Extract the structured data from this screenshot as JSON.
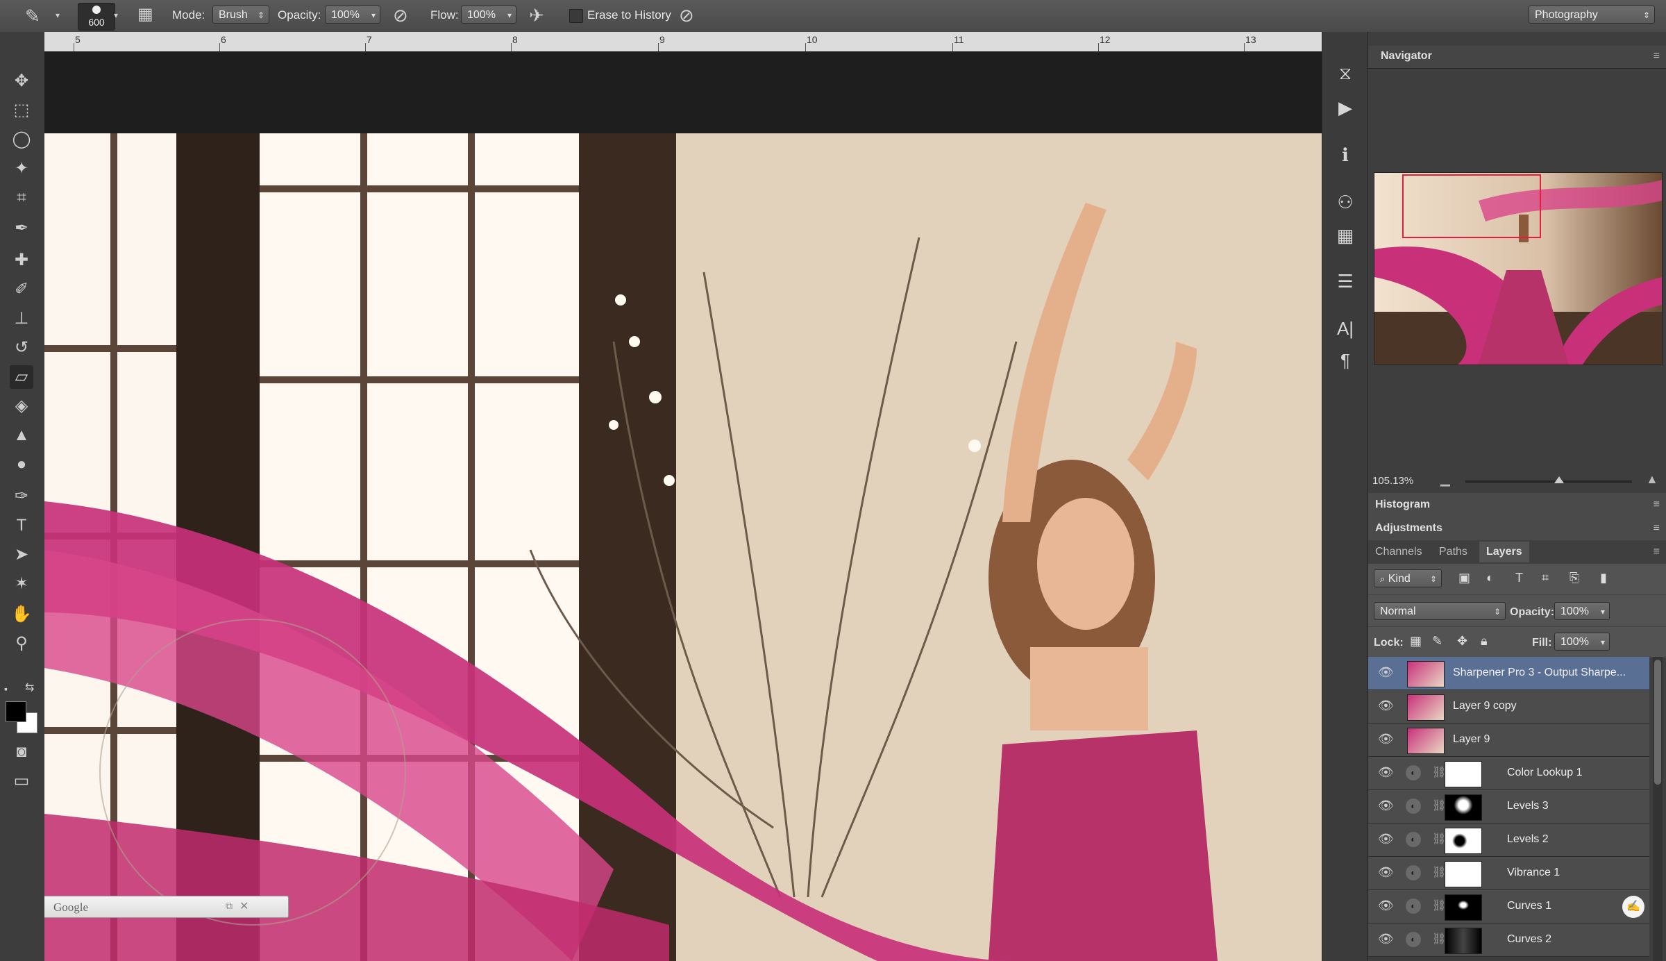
{
  "options_bar": {
    "brush_size": "600",
    "mode_label": "Mode:",
    "mode_value": "Brush",
    "opacity_label": "Opacity:",
    "opacity_value": "100%",
    "flow_label": "Flow:",
    "flow_value": "100%",
    "erase_to_history": "Erase to History",
    "workspace": "Photography"
  },
  "ruler": {
    "marks": [
      "5",
      "6",
      "7",
      "8",
      "9",
      "10",
      "11",
      "12",
      "13"
    ]
  },
  "google_search": {
    "placeholder": "Google"
  },
  "navigator": {
    "title": "Navigator",
    "zoom": "105.13%"
  },
  "panels": {
    "histogram": "Histogram",
    "adjustments": "Adjustments",
    "tabs": [
      "Channels",
      "Paths",
      "Layers"
    ]
  },
  "layers_panel": {
    "filter_kind": "Kind",
    "blend_mode": "Normal",
    "opacity_label": "Opacity:",
    "opacity_value": "100%",
    "lock_label": "Lock:",
    "fill_label": "Fill:",
    "fill_value": "100%",
    "layers": [
      {
        "name": "Sharpener Pro 3 - Output Sharpe...",
        "type": "pixel",
        "selected": true
      },
      {
        "name": "Layer 9 copy",
        "type": "pixel",
        "selected": false
      },
      {
        "name": "Layer 9",
        "type": "pixel",
        "selected": false
      },
      {
        "name": "Color Lookup 1",
        "type": "adjustment",
        "selected": false
      },
      {
        "name": "Levels 3",
        "type": "adjustment",
        "selected": false
      },
      {
        "name": "Levels 2",
        "type": "adjustment",
        "selected": false
      },
      {
        "name": "Vibrance 1",
        "type": "adjustment",
        "selected": false
      },
      {
        "name": "Curves 1",
        "type": "adjustment",
        "selected": false
      },
      {
        "name": "Curves 2",
        "type": "adjustment",
        "selected": false
      }
    ]
  },
  "colors": {
    "accent_selected_layer": "#5a6f94",
    "fabric_pink": "#c2306f",
    "panel_bg": "#3e3e3e"
  }
}
